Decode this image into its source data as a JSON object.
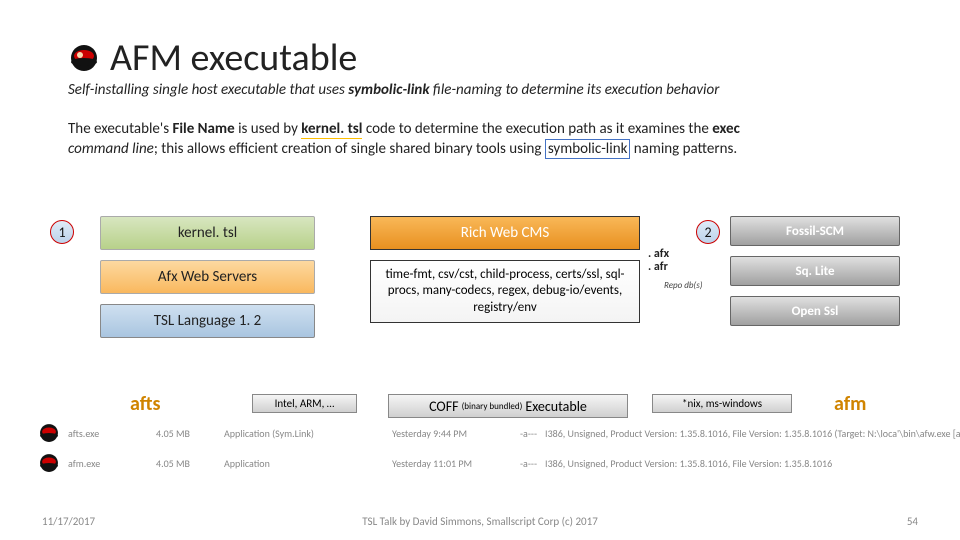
{
  "title": "AFM executable",
  "subtitle_pre": "Self-installing single host executable that uses ",
  "subtitle_bold": "symbolic-link",
  "subtitle_post": " file-naming to determine its execution behavior",
  "desc": {
    "p1a": "The executable's ",
    "p1b": "File Name",
    "p1c": " is used by ",
    "p1d": "kernel. tsl",
    "p1e": " code to determine the execution path as it examines the ",
    "p1f": "exec",
    "p2a": "command line",
    "p2b": "; this allows efficient creation of single shared binary tools using ",
    "p2c": "symbolic-link",
    "p2d": " naming patterns."
  },
  "circles": {
    "one": "1",
    "two": "2"
  },
  "left_col": [
    "kernel. tsl",
    "Afx Web Servers",
    "TSL Language 1. 2"
  ],
  "mid_col": {
    "header": "Rich Web CMS",
    "body": "time-fmt, csv/cst, child-process, certs/ssl, sql-procs, many-codecs, regex, debug-io/events, registry/env"
  },
  "right_col": [
    "Fossil-SCM",
    "Sq. Lite",
    "Open Ssl"
  ],
  "side_labels": {
    "afx": ". afx",
    "afr": ". afr",
    "repo": "Repo db(s)"
  },
  "row2": {
    "afts": "afts",
    "intel": "Intel, ARM, …",
    "coff_pre": "COFF",
    "coff_mid": "(binary bundled)",
    "coff_post": " Executable",
    "nix": "*nix, ms-windows",
    "afm": "afm"
  },
  "files": [
    {
      "name": "afts.exe",
      "size": "4.05 MB",
      "type": "Application (Sym.Link)",
      "date": "Yesterday   9:44 PM",
      "attr": "-a---",
      "detail": "I386, Unsigned, Product Version: 1.35.8.1016, File Version: 1.35.8.1016 (Target: N:\\loca'\\bin\\afw.exe [afr.exe])"
    },
    {
      "name": "afm.exe",
      "size": "4.05 MB",
      "type": "Application",
      "date": "Yesterday   11:01 PM",
      "attr": "-a---",
      "detail": "I386, Unsigned, Product Version: 1.35.8.1016, File Version: 1.35.8.1016"
    }
  ],
  "footer": {
    "date": "11/17/2017",
    "center": "TSL Talk by David Simmons, Smallscript Corp (c) 2017",
    "page": "54"
  }
}
